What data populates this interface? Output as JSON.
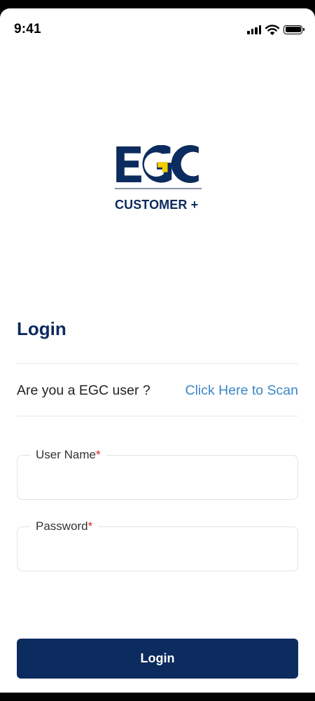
{
  "status_bar": {
    "time": "9:41"
  },
  "icons": {
    "signal": "cellular-signal-icon",
    "wifi": "wifi-icon",
    "battery": "battery-icon"
  },
  "brand": {
    "logo_text": "EGC",
    "sub_text": "CUSTOMER +",
    "primary_color": "#0c2b5e",
    "accent_color": "#f2cd00"
  },
  "login": {
    "title": "Login",
    "scan_question": "Are you a EGC user ?",
    "scan_link": "Click Here to Scan",
    "link_color": "#3d86c6",
    "fields": {
      "username": {
        "label": "User Name",
        "required_mark": "*",
        "value": ""
      },
      "password": {
        "label": "Password",
        "required_mark": "*",
        "value": ""
      }
    },
    "button_label": "Login"
  }
}
